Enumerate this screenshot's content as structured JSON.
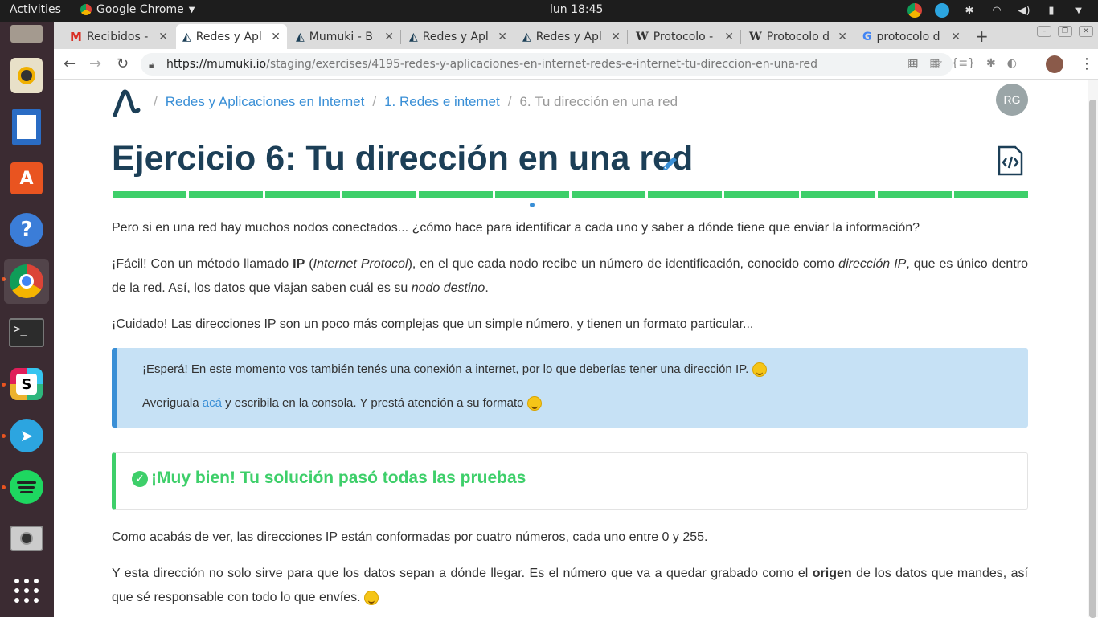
{
  "topbar": {
    "activities": "Activities",
    "app_name": "Google Chrome",
    "clock": "lun 18:45"
  },
  "dock": {
    "items": [
      "files-icon",
      "rhythmbox-icon",
      "writer-icon",
      "software-center-icon",
      "help-icon",
      "chrome-icon",
      "terminal-icon",
      "slack-icon",
      "telegram-icon",
      "spotify-icon",
      "camera-icon",
      "apps-grid-icon"
    ]
  },
  "tabs": [
    {
      "title": "Recibidos - ",
      "icon": "gmail-icon"
    },
    {
      "title": "Redes y Apl",
      "icon": "mumuki-icon"
    },
    {
      "title": "Mumuki - B",
      "icon": "mumuki-icon"
    },
    {
      "title": "Redes y Apl",
      "icon": "mumuki-icon"
    },
    {
      "title": "Redes y Apl",
      "icon": "mumuki-icon"
    },
    {
      "title": "Protocolo -",
      "icon": "wikipedia-icon"
    },
    {
      "title": "Protocolo d",
      "icon": "wikipedia-icon"
    },
    {
      "title": "protocolo d",
      "icon": "google-icon"
    }
  ],
  "address": {
    "host": "https://mumuki.io",
    "path": "/staging/exercises/4195-redes-y-aplicaciones-en-internet-redes-e-internet-tu-direccion-en-una-red"
  },
  "breadcrumb": {
    "items": [
      "Redes y Aplicaciones en Internet",
      "1. Redes e internet"
    ],
    "current": "6. Tu dirección en una red"
  },
  "user": {
    "initials": "RG"
  },
  "exercise": {
    "title": "Ejercicio 6:  Tu dirección en una red",
    "progress_segments": 12,
    "current_segment": 6
  },
  "content": {
    "p1": "Pero si en una red hay muchos nodos conectados... ¿cómo hace para identificar a cada uno y saber a dónde tiene que enviar la información?",
    "p2_a": "¡Fácil! Con un método llamado ",
    "p2_b": "IP",
    "p2_c": " (",
    "p2_d": "Internet Protocol",
    "p2_e": "), en el que cada nodo recibe un número de identificación, conocido como ",
    "p2_f": "dirección IP",
    "p2_g": ", que es único dentro de la red. Así, los datos que viajan saben cuál es su ",
    "p2_h": "nodo destino",
    "p2_i": ".",
    "p3": "¡Cuidado! Las direcciones IP son un poco más complejas que un simple número, y tienen un formato particular...",
    "info_1": "¡Esperá! En este momento vos también tenés una conexión a internet, por lo que deberías tener una dirección IP.",
    "info_2_a": "Averiguala ",
    "info_2_link": "acá",
    "info_2_b": " y escribila en la consola. Y prestá atención a su formato",
    "success": "¡Muy bien! Tu solución pasó todas las pruebas",
    "p4": "Como acabás de ver, las direcciones IP están conformadas por cuatro números, cada uno entre 0 y 255.",
    "p5_a": "Y esta dirección no solo sirve para que los datos sepan a dónde llegar. Es el número que va a quedar grabado como el ",
    "p5_b": "origen",
    "p5_c": " de los datos que mandes, así que sé responsable con todo lo que envíes."
  }
}
